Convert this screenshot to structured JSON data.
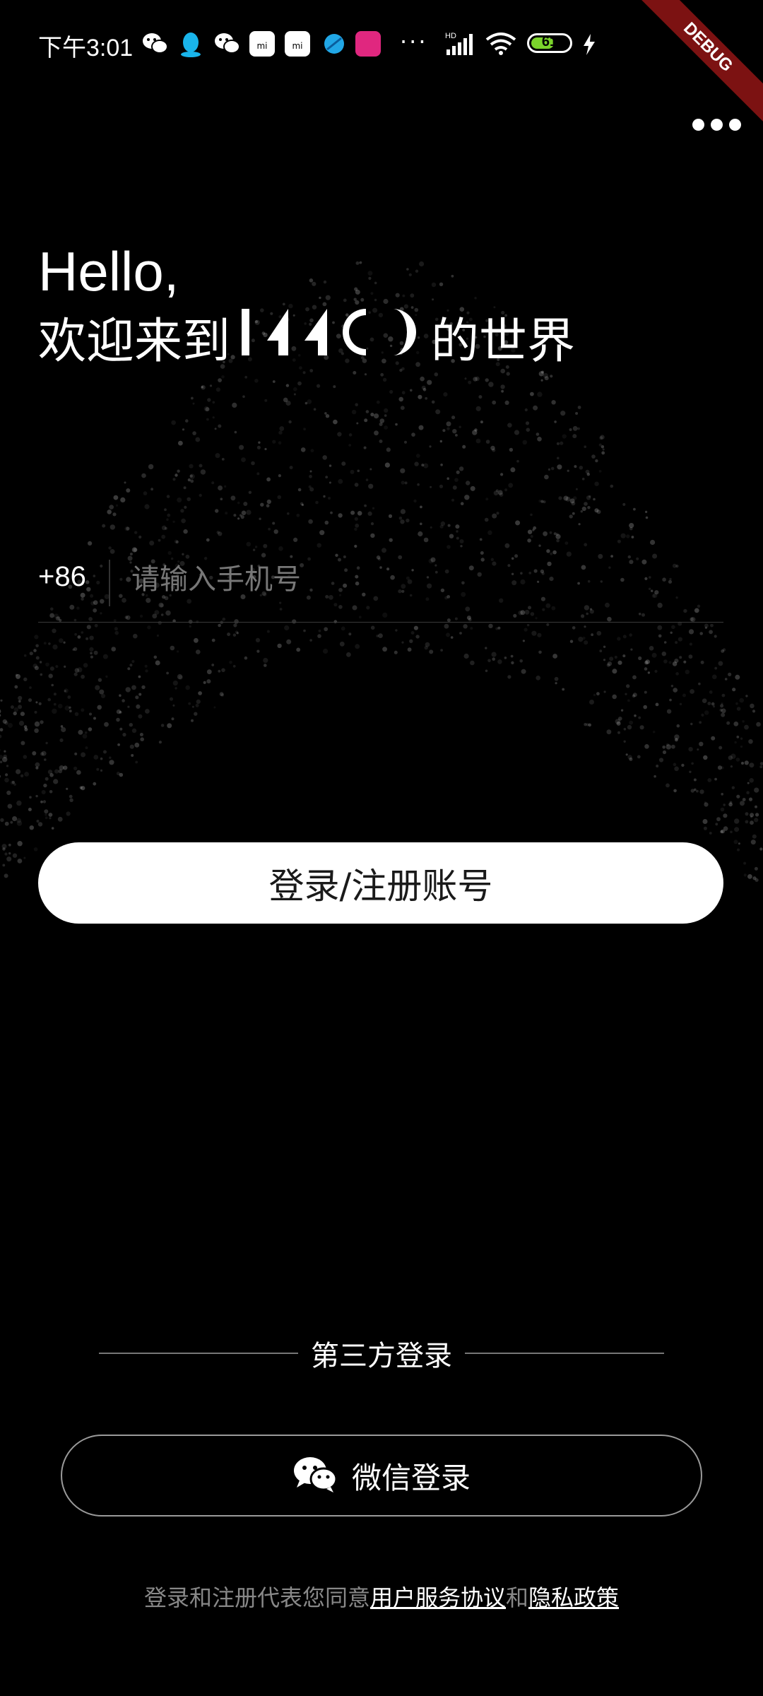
{
  "status_bar": {
    "time": "下午3:01",
    "notification_icons": [
      "wechat-icon",
      "qq-icon",
      "wechat-icon",
      "mi-store-icon",
      "mi-store-icon",
      "browser-icon",
      "app-icon"
    ],
    "more_notifications": "···",
    "network": "HD",
    "battery_percent": "61",
    "battery_level": 0.61,
    "charging": true
  },
  "debug_banner": "DEBUG",
  "greeting": {
    "hello": "Hello,",
    "welcome_prefix": "欢迎来到",
    "welcome_suffix": "的世界"
  },
  "phone": {
    "country_code": "+86",
    "placeholder": "请输入手机号",
    "value": ""
  },
  "login_button": "登录/注册账号",
  "third_party": {
    "title": "第三方登录",
    "wechat_label": "微信登录"
  },
  "agreement": {
    "prefix": "登录和注册代表您同意",
    "user_agreement": "用户服务协议",
    "conjunction": "和",
    "privacy_policy": "隐私政策"
  },
  "colors": {
    "background": "#000000",
    "debug_banner": "#7c1212",
    "battery_fill": "#7bd32c",
    "muted_text": "#888888"
  }
}
